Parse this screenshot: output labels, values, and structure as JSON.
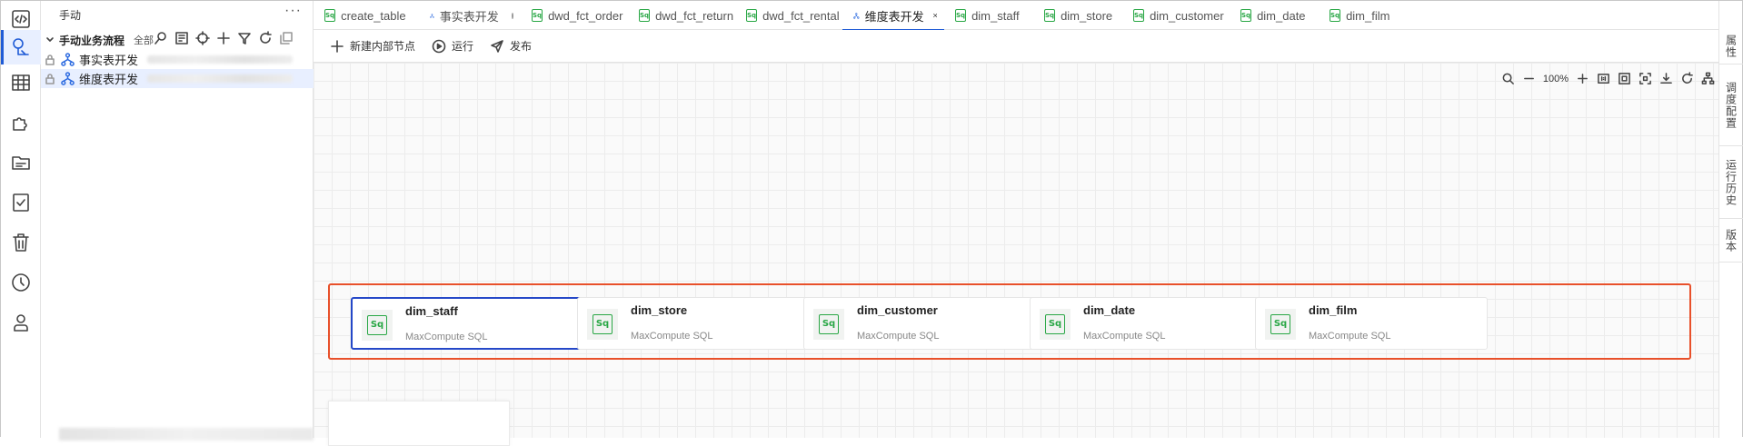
{
  "sidebar": {
    "title": "手动",
    "more": "···",
    "group": {
      "label": "手动业务流程",
      "all_label": "全部"
    },
    "items": [
      {
        "label": "事实表开发"
      },
      {
        "label": "维度表开发"
      }
    ]
  },
  "tabs": [
    {
      "label": "create_table",
      "kind": "sql"
    },
    {
      "label": "事实表开发",
      "kind": "flow"
    },
    {
      "label": "dwd_fct_order",
      "kind": "sql"
    },
    {
      "label": "dwd_fct_return",
      "kind": "sql"
    },
    {
      "label": "dwd_fct_rental",
      "kind": "sql"
    },
    {
      "label": "维度表开发",
      "kind": "flow",
      "active": true
    },
    {
      "label": "dim_staff",
      "kind": "sql"
    },
    {
      "label": "dim_store",
      "kind": "sql"
    },
    {
      "label": "dim_customer",
      "kind": "sql"
    },
    {
      "label": "dim_date",
      "kind": "sql"
    },
    {
      "label": "dim_film",
      "kind": "sql"
    }
  ],
  "icon_text": {
    "sql": "Sq"
  },
  "toolbar": {
    "new_node": "新建内部节点",
    "run": "运行",
    "publish": "发布"
  },
  "zoom": {
    "level": "100%"
  },
  "nodes": [
    {
      "name": "dim_staff",
      "type": "MaxCompute SQL",
      "selected": true
    },
    {
      "name": "dim_store",
      "type": "MaxCompute SQL"
    },
    {
      "name": "dim_customer",
      "type": "MaxCompute SQL"
    },
    {
      "name": "dim_date",
      "type": "MaxCompute SQL"
    },
    {
      "name": "dim_film",
      "type": "MaxCompute SQL"
    }
  ],
  "right_panel": [
    {
      "label": "属性"
    },
    {
      "label": "调度配置"
    },
    {
      "label": "运行历史"
    },
    {
      "label": "版本"
    }
  ],
  "colors": {
    "accent": "#1f5bd6",
    "sql_green": "#29a745",
    "highlight": "#e8502a",
    "selected_border": "#2548c8"
  }
}
